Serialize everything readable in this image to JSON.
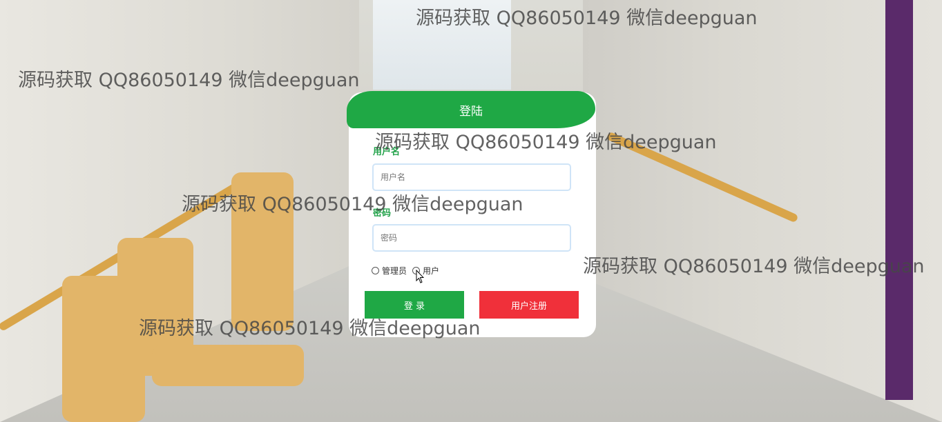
{
  "login": {
    "title": "登陆",
    "username_label": "用户名",
    "username_placeholder": "用户名",
    "password_label": "密码",
    "password_placeholder": "密码",
    "roles": [
      "管理员",
      "用户"
    ],
    "login_button": "登 录",
    "register_button": "用户注册"
  },
  "watermark": {
    "text": "源码获取 QQ86050149 微信deepguan"
  },
  "colors": {
    "header_green": "#1fa845",
    "label_green": "#22a24a",
    "register_red": "#f0303a"
  }
}
